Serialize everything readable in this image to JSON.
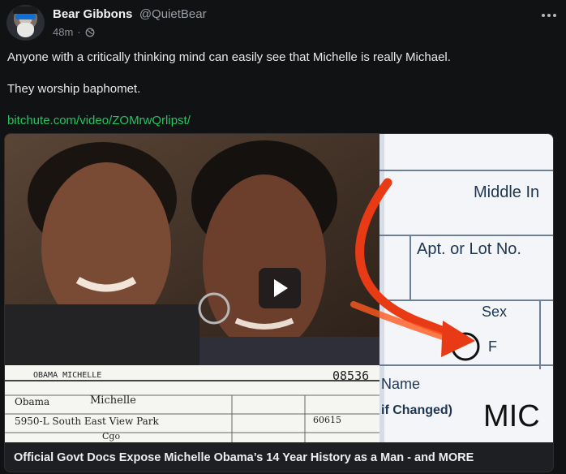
{
  "post": {
    "author": {
      "display_name": "Bear Gibbons",
      "handle": "@QuietBear"
    },
    "time_ago": "48m",
    "visibility_icon": "globe-icon",
    "more_icon": "more-horizontal-icon",
    "paragraphs": [
      "Anyone with a critically thinking mind can easily see that Michelle is really Michael.",
      "They worship baphomet."
    ],
    "link": "bitchute.com/video/ZOMrwQrlipst/",
    "link_color": "#22c55e"
  },
  "card": {
    "title": "Official Govt Docs Expose Michelle Obama’s 14 Year History as a Man - and MORE",
    "play_icon": "play-icon",
    "thumbnail_text": {
      "doc_header": "OBAMA MICHELLE",
      "doc_number": "08536",
      "doc_first_name": "Michelle",
      "doc_last_name": "Obama",
      "doc_address": "5950-L South East View Park",
      "doc_city": "Cgo",
      "doc_zip": "60615",
      "form_middle": "Middle In",
      "form_apt": "Apt. or Lot No.",
      "form_sex": "Sex",
      "form_f": "F",
      "form_name": "Name",
      "form_changed": "if Changed)",
      "form_mic": "MIC"
    }
  }
}
